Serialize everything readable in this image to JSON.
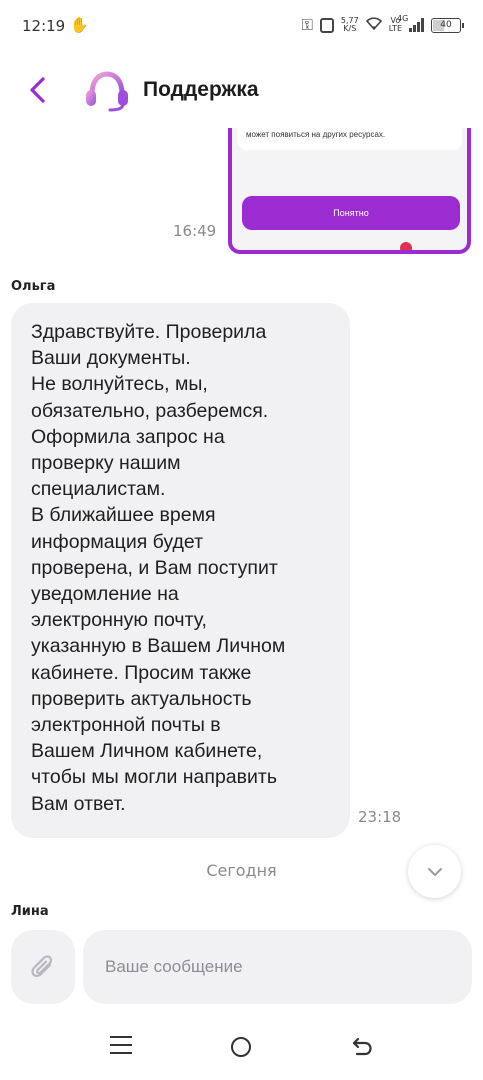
{
  "status_bar": {
    "time": "12:19",
    "speed_value": "5,77",
    "speed_unit": "K/S",
    "volte_top": "Vo",
    "volte_bottom": "LTE",
    "network_gen": "4G",
    "battery": "40"
  },
  "header": {
    "title": "Поддержка",
    "accent_color": "#9b2cd2"
  },
  "preview": {
    "text": "может появиться на других ресурсах.",
    "button_label": "Понятно",
    "time": "16:49"
  },
  "agent_message": {
    "sender": "Ольга",
    "text": "Здравствуйте. Проверила\nВаши документы.\nНе волнуйтесь, мы,\nобязательно, разберемся.\nОформила запрос на\nпроверку нашим\nспециалистам.\nВ ближайшее время\nинформация будет\nпроверена, и Вам поступит\nуведомление на\nэлектронную почту,\nуказанную в Вашем Личном\nкабинете. Просим также\nпроверить актуальность\nэлектронной почты в\nВашем Личном кабинете,\nчтобы мы могли направить\nВам ответ.",
    "time": "23:18"
  },
  "date_separator": "Сегодня",
  "composer": {
    "sender": "Лина",
    "placeholder": "Ваше сообщение"
  }
}
